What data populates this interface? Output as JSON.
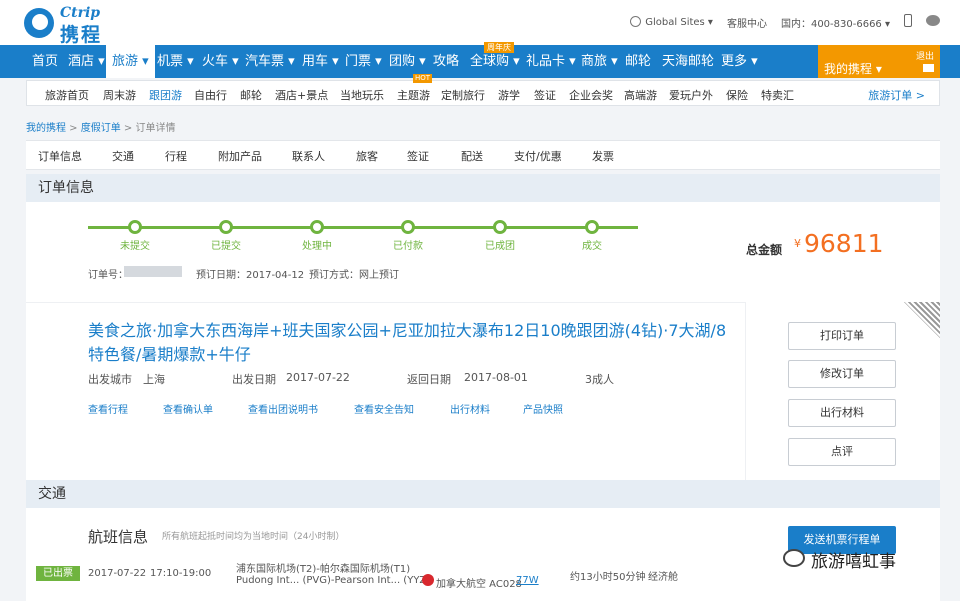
{
  "header": {
    "logo_en": "Ctrip",
    "logo_cn": "携程",
    "global_sites": "Global Sites ▾",
    "service": "客服中心",
    "hotline": "国内：400-830-6666 ▾"
  },
  "nav": {
    "items": [
      "首页",
      "酒店 ▾",
      "旅游 ▾",
      "机票 ▾",
      "火车 ▾",
      "汽车票 ▾",
      "用车 ▾",
      "门票 ▾",
      "团购 ▾",
      "攻略",
      "全球购 ▾",
      "礼品卡 ▾",
      "商旅 ▾",
      "邮轮",
      "天海邮轮",
      "更多 ▾"
    ],
    "anniv_tag": "周年庆",
    "my_trip": "我的携程 ▾",
    "logout": "退出"
  },
  "subnav": {
    "items": [
      "旅游首页",
      "周末游",
      "跟团游",
      "自由行",
      "邮轮",
      "酒店+景点",
      "当地玩乐",
      "主题游",
      "定制旅行",
      "游学",
      "签证",
      "企业会奖",
      "高端游",
      "爱玩户外",
      "保险",
      "特卖汇"
    ],
    "hot_tag": "HOT",
    "orders": "旅游订单 >"
  },
  "breadcrumb": {
    "home": "我的携程",
    "sep1": " > ",
    "orders": "度假订单",
    "sep2": " > 订单详情"
  },
  "tabs": [
    "订单信息",
    "交通",
    "行程",
    "附加产品",
    "联系人",
    "旅客",
    "签证",
    "配送",
    "支付/优惠",
    "发票"
  ],
  "order_info": {
    "section_title": "订单信息",
    "steps": [
      "未提交",
      "已提交",
      "处理中",
      "已付款",
      "已成团",
      "成交"
    ],
    "order_no_label": "订单号：",
    "book_date": "预订日期：2017-04-12",
    "book_method": "预订方式：网上预订",
    "total_label": "总金额",
    "currency": "¥",
    "total_value": "96811"
  },
  "product": {
    "title": "美食之旅·加拿大东西海岸+班夫国家公园+尼亚加拉大瀑布12日10晚跟团游(4钻)·7大湖/8特色餐/暑期爆款+牛仔",
    "departure_city_label": "出发城市",
    "departure_city": "上海",
    "departure_date_label": "出发日期",
    "departure_date": "2017-07-22",
    "return_date_label": "返回日期",
    "return_date": "2017-08-01",
    "travelers": "3成人",
    "links": [
      "查看行程",
      "查看确认单",
      "查看出团说明书",
      "查看安全告知",
      "出行材料",
      "产品快照"
    ],
    "buttons": [
      "打印订单",
      "修改订单",
      "出行材料",
      "点评"
    ]
  },
  "traffic": {
    "section_title": "交通",
    "flight_title": "航班信息",
    "flight_note": "所有航班起抵时间均为当地时间（24小时制）",
    "status": "已出票",
    "date": "2017-07-22",
    "time": "17:10-19:00",
    "route_cn": "浦东国际机场(T2)-帕尔森国际机场(T1)",
    "route_en": "Pudong Int... (PVG)-Pearson Int... (YYZ)",
    "airline": "加拿大航空 AC028",
    "aircraft": "77W",
    "duration": "约13小时50分钟",
    "cabin": "经济舱",
    "send_button": "发送机票行程单"
  },
  "watermark": "旅游嘻虹事"
}
